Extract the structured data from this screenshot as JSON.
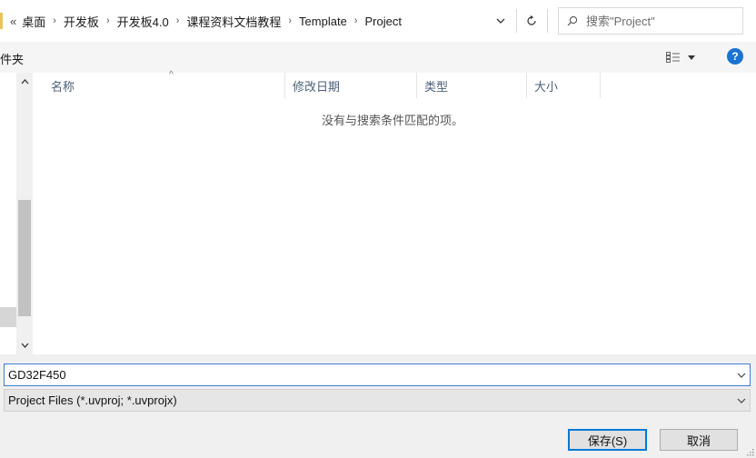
{
  "address_bar": {
    "overflow": "«",
    "crumbs": [
      "桌面",
      "开发板",
      "开发板4.0",
      "课程资料文档教程",
      "Template",
      "Project"
    ],
    "search_placeholder": "搜索\"Project\""
  },
  "toolbar": {
    "left_label": "件夹",
    "help_label": "?"
  },
  "file_list": {
    "columns": [
      "名称",
      "修改日期",
      "类型",
      "大小"
    ],
    "empty_message": "没有与搜索条件匹配的项。"
  },
  "save_form": {
    "filename_value": "GD32F450",
    "filetype_value": "Project Files (*.uvproj; *.uvprojx)",
    "save_label": "保存(S)",
    "cancel_label": "取消"
  },
  "colors": {
    "accent": "#0078d7",
    "help_icon": "#1a73d1",
    "column_header_text": "#4c607a"
  },
  "icons": [
    "chevron-right-icon",
    "chevron-down-icon",
    "refresh-icon",
    "search-icon",
    "view-options-icon",
    "help-icon",
    "scroll-up-icon",
    "scroll-down-icon"
  ]
}
